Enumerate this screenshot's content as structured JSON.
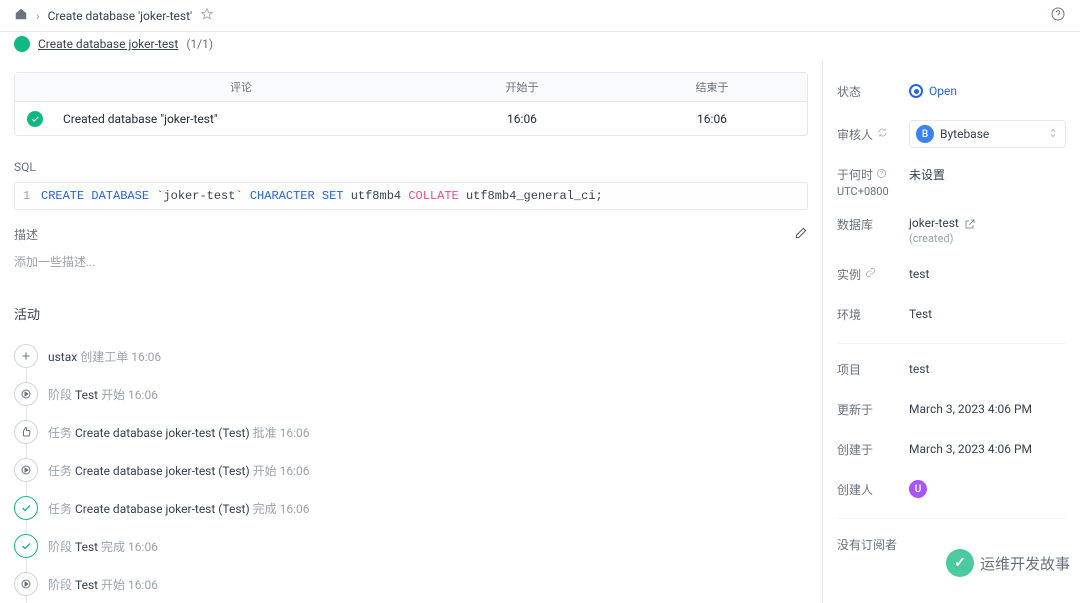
{
  "breadcrumb": {
    "title": "Create database 'joker-test'"
  },
  "stage": {
    "link": "Create database joker-test",
    "count": "(1/1)"
  },
  "task_table": {
    "headers": {
      "comment": "评论",
      "start": "开始于",
      "end": "结束于"
    },
    "row": {
      "comment": "Created database \"joker-test\"",
      "start": "16:06",
      "end": "16:06"
    }
  },
  "sql": {
    "label": "SQL",
    "line_no": "1",
    "kw_create": "CREATE DATABASE",
    "name": "`joker-test`",
    "kw_charset": "CHARACTER SET",
    "charset": "utf8mb4",
    "kw_collate": "COLLATE",
    "collate": "utf8mb4_general_ci;"
  },
  "desc": {
    "label": "描述",
    "placeholder": "添加一些描述..."
  },
  "activity": {
    "title": "活动",
    "items": [
      {
        "icon": "plus",
        "color": "gray",
        "who": "ustax",
        "text": "创建工单",
        "time": "16:06"
      },
      {
        "icon": "play",
        "color": "gray",
        "prefix": "阶段",
        "link": "Test",
        "text": "开始",
        "time": "16:06"
      },
      {
        "icon": "thumb",
        "color": "gray",
        "prefix": "任务",
        "link": "Create database joker-test (Test)",
        "text": "批准",
        "time": "16:06"
      },
      {
        "icon": "play",
        "color": "gray",
        "prefix": "任务",
        "link": "Create database joker-test (Test)",
        "text": "开始",
        "time": "16:06"
      },
      {
        "icon": "check",
        "color": "green",
        "prefix": "任务",
        "link": "Create database joker-test (Test)",
        "text": "完成",
        "time": "16:06"
      },
      {
        "icon": "check",
        "color": "green",
        "prefix": "阶段",
        "link": "Test",
        "text": "完成",
        "time": "16:06"
      },
      {
        "icon": "play",
        "color": "gray",
        "prefix": "阶段",
        "link": "Test",
        "text": "开始",
        "time": "16:06"
      }
    ]
  },
  "side": {
    "status_label": "状态",
    "status_value": "Open",
    "reviewer_label": "审核人",
    "reviewer_initial": "B",
    "reviewer_name": "Bytebase",
    "when_label": "于何时",
    "when_tz": "UTC+0800",
    "when_value": "未设置",
    "db_label": "数据库",
    "db_name": "joker-test",
    "db_status": "(created)",
    "instance_label": "实例",
    "instance_value": "test",
    "env_label": "环境",
    "env_value": "Test",
    "project_label": "项目",
    "project_value": "test",
    "updated_label": "更新于",
    "updated_value": "March 3, 2023 4:06 PM",
    "created_label": "创建于",
    "created_value": "March 3, 2023 4:06 PM",
    "creator_label": "创建人",
    "creator_initial": "U",
    "sub_label": "没有订阅者"
  },
  "watermark": "运维开发故事"
}
